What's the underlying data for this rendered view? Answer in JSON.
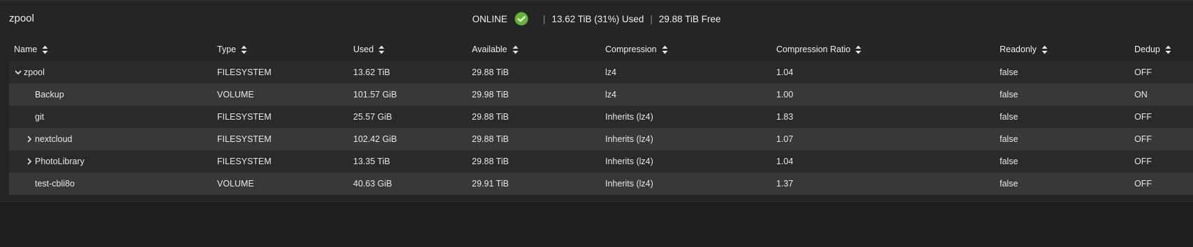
{
  "pool": {
    "name": "zpool",
    "status": "ONLINE",
    "used": "13.62 TiB (31%) Used",
    "free": "29.88 TiB Free",
    "separator": "|"
  },
  "columns": [
    "Name",
    "Type",
    "Used",
    "Available",
    "Compression",
    "Compression Ratio",
    "Readonly",
    "Dedup"
  ],
  "rows": [
    {
      "name": "zpool",
      "type": "FILESYSTEM",
      "used": "13.62 TiB",
      "available": "29.88 TiB",
      "compression": "lz4",
      "ratio": "1.04",
      "readonly": "false",
      "dedup": "OFF"
    },
    {
      "name": "Backup",
      "type": "VOLUME",
      "used": "101.57 GiB",
      "available": "29.98 TiB",
      "compression": "lz4",
      "ratio": "1.00",
      "readonly": "false",
      "dedup": "ON"
    },
    {
      "name": "git",
      "type": "FILESYSTEM",
      "used": "25.57 GiB",
      "available": "29.88 TiB",
      "compression": "Inherits (lz4)",
      "ratio": "1.83",
      "readonly": "false",
      "dedup": "OFF"
    },
    {
      "name": "nextcloud",
      "type": "FILESYSTEM",
      "used": "102.42 GiB",
      "available": "29.88 TiB",
      "compression": "Inherits (lz4)",
      "ratio": "1.07",
      "readonly": "false",
      "dedup": "OFF"
    },
    {
      "name": "PhotoLibrary",
      "type": "FILESYSTEM",
      "used": "13.35 TiB",
      "available": "29.88 TiB",
      "compression": "Inherits (lz4)",
      "ratio": "1.04",
      "readonly": "false",
      "dedup": "OFF"
    },
    {
      "name": "test-cbli8o",
      "type": "VOLUME",
      "used": "40.63 GiB",
      "available": "29.91 TiB",
      "compression": "Inherits (lz4)",
      "ratio": "1.37",
      "readonly": "false",
      "dedup": "OFF"
    }
  ],
  "icons": {
    "status": "check-circle-icon",
    "sort": "sort-icon",
    "expanded": "chevron-down-icon",
    "collapsed": "chevron-right-icon"
  },
  "colors": {
    "online": "#5fb832"
  }
}
